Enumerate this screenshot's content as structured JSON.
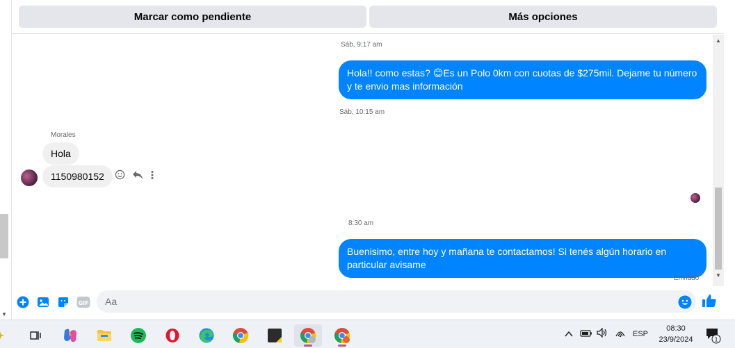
{
  "top_actions": {
    "mark_pending": "Marcar como pendiente",
    "more_options": "Más opciones"
  },
  "messages": {
    "ts1": "Sáb, 9:17 am",
    "out1": "Hola!! como estas? 😊Es un Polo 0km con cuotas de $275mil. Dejame tu número y te envio mas información",
    "ts2": "Sáb, 10:15 am",
    "sender": "Morales",
    "in1": "Hola",
    "in2": "1150980152",
    "ts3": "8:30 am",
    "out2": "Buenisimo, entre hoy y mañana te contactamos! Si tenés algún horario en particular avisame",
    "status": "Enviado"
  },
  "composer": {
    "placeholder": "Aa",
    "gif_label": "GIF"
  },
  "taskbar": {
    "language": "ESP",
    "time": "08:30",
    "date": "23/9/2024",
    "notification_count": "1"
  },
  "colors": {
    "accent": "#0084ff",
    "bubble_in": "#f0f0f0"
  }
}
